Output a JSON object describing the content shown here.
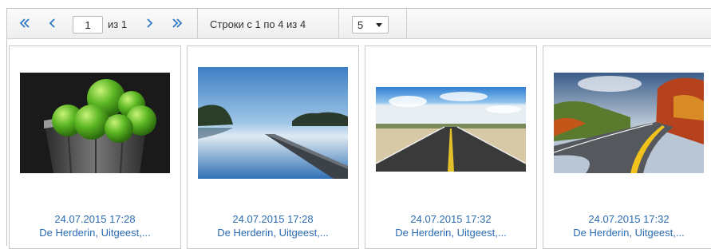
{
  "pager": {
    "first_icon": "double-chevron-left-icon",
    "prev_icon": "chevron-left-icon",
    "next_icon": "chevron-right-icon",
    "last_icon": "double-chevron-right-icon",
    "current_page": "1",
    "of_label": "из 1",
    "rows_label": "Строки с 1 по 4 из 4",
    "page_size": "5",
    "accent_color": "#2f78c4"
  },
  "cards": [
    {
      "image": "green-apples-in-bucket",
      "date": "24.07.2015 17:28",
      "place": "De Herderin, Uitgeest,..."
    },
    {
      "image": "lake-pier-at-dawn",
      "date": "24.07.2015 17:28",
      "place": "De Herderin, Uitgeest,..."
    },
    {
      "image": "desert-highway",
      "date": "24.07.2015 17:32",
      "place": "De Herderin, Uitgeest,..."
    },
    {
      "image": "autumn-road",
      "date": "24.07.2015 17:32",
      "place": "De Herderin, Uitgeest,..."
    }
  ],
  "colors": {
    "caption_text": "#2a6bb3",
    "pager_bg": "#eeeeee",
    "border": "#c9c9c9"
  }
}
